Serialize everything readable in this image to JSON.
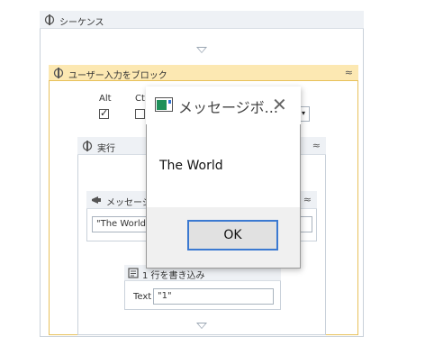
{
  "sequence": {
    "title": "シーケンス"
  },
  "block_input": {
    "title": "ユーザー入力をブロック",
    "keys": [
      {
        "label": "Alt",
        "checked": true
      },
      {
        "label": "Ct",
        "checked": false
      }
    ]
  },
  "do_block": {
    "title": "実行"
  },
  "message_activity": {
    "title": "メッセージボ",
    "text_value": "\"The World\""
  },
  "write_line": {
    "title": "1 行を書き込み",
    "text_label": "Text",
    "text_value": "\"1\""
  },
  "dialog": {
    "title": "メッセージボ...",
    "message": "The World",
    "ok_label": "OK",
    "close_glyph": "✕"
  },
  "colors": {
    "block_header": "#fce8b2",
    "block_border": "#e8c15a",
    "ok_border": "#3b79d1"
  }
}
